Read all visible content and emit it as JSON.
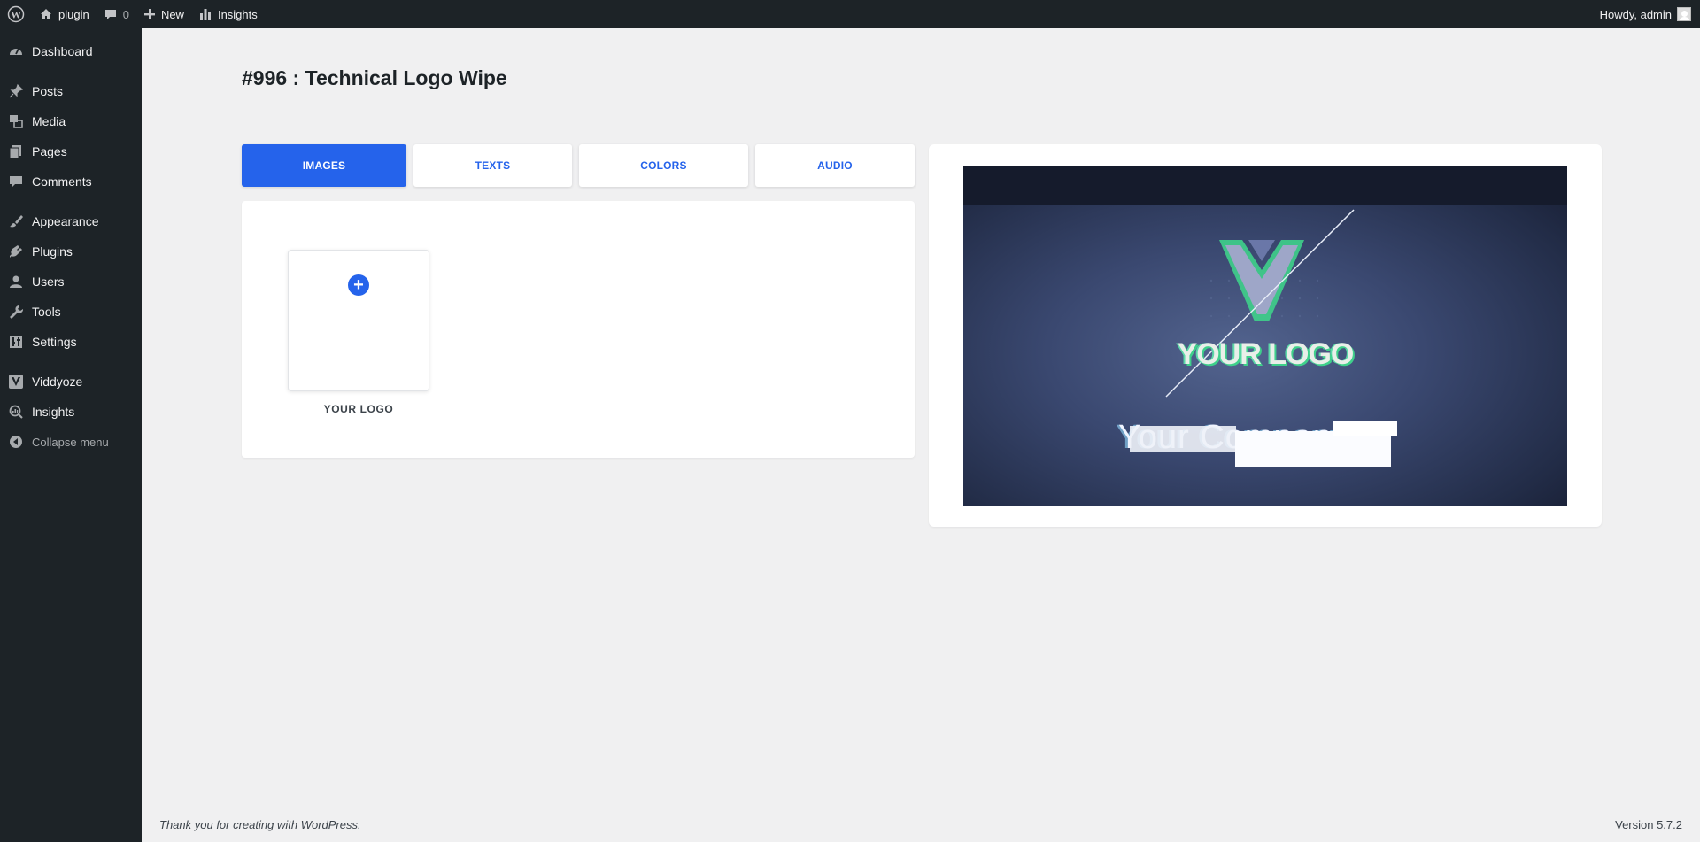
{
  "adminbar": {
    "site_name": "plugin",
    "comments_count": "0",
    "new_label": "New",
    "insights_label": "Insights",
    "greeting": "Howdy, admin"
  },
  "sidebar": {
    "items": [
      {
        "label": "Dashboard",
        "icon": "dashboard-icon"
      },
      {
        "label": "Posts",
        "icon": "pin-icon"
      },
      {
        "label": "Media",
        "icon": "media-icon"
      },
      {
        "label": "Pages",
        "icon": "pages-icon"
      },
      {
        "label": "Comments",
        "icon": "comment-icon"
      },
      {
        "label": "Appearance",
        "icon": "brush-icon"
      },
      {
        "label": "Plugins",
        "icon": "plug-icon"
      },
      {
        "label": "Users",
        "icon": "user-icon"
      },
      {
        "label": "Tools",
        "icon": "wrench-icon"
      },
      {
        "label": "Settings",
        "icon": "settings-icon"
      },
      {
        "label": "Viddyoze",
        "icon": "viddyoze-v-icon"
      },
      {
        "label": "Insights",
        "icon": "insights-icon"
      }
    ],
    "collapse_label": "Collapse menu"
  },
  "page": {
    "title": "#996 : Technical Logo Wipe"
  },
  "tabs": [
    {
      "label": "IMAGES",
      "active": true
    },
    {
      "label": "TEXTS",
      "active": false
    },
    {
      "label": "COLORS",
      "active": false
    },
    {
      "label": "AUDIO",
      "active": false
    }
  ],
  "images_panel": {
    "logo_label": "YOUR LOGO"
  },
  "preview": {
    "logo_text": "YOUR LOGO",
    "company_text": "Your Company"
  },
  "footer": {
    "thanks": "Thank you for creating with WordPress.",
    "version": "Version 5.7.2"
  },
  "colors": {
    "accent": "#2563eb",
    "admin_bg": "#1d2327",
    "page_bg": "#f0f0f1"
  }
}
